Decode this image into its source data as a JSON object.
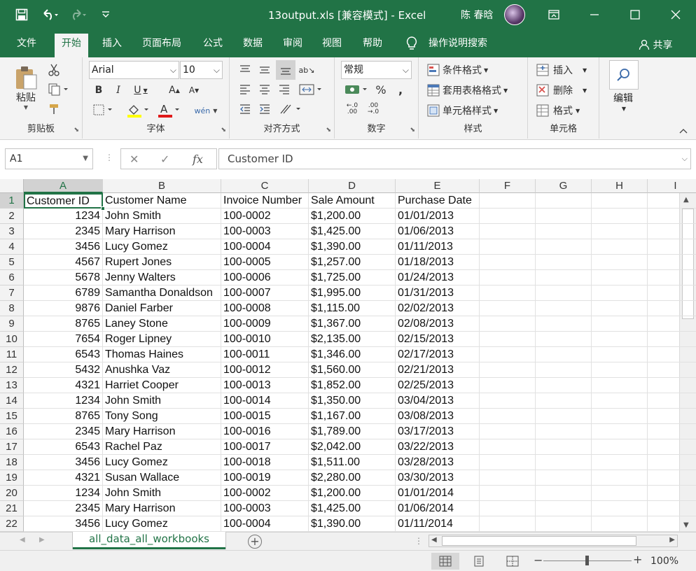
{
  "window": {
    "title": "13output.xls  [兼容模式]  -  Excel",
    "user": "陈 春晗"
  },
  "menu": {
    "tabs": [
      "文件",
      "开始",
      "插入",
      "页面布局",
      "公式",
      "数据",
      "审阅",
      "视图",
      "帮助"
    ],
    "active_tab": "开始",
    "tell_me": "操作说明搜索",
    "share": "共享"
  },
  "ribbon": {
    "clipboard": {
      "label": "剪贴板",
      "paste": "粘贴"
    },
    "font": {
      "label": "字体",
      "font_name": "Arial",
      "font_size": "10"
    },
    "alignment": {
      "label": "对齐方式"
    },
    "number": {
      "label": "数字",
      "format": "常规"
    },
    "styles": {
      "label": "样式",
      "conditional": "条件格式",
      "table": "套用表格格式",
      "cell_styles": "单元格样式"
    },
    "cells": {
      "label": "单元格",
      "insert": "插入",
      "delete": "删除",
      "format": "格式"
    },
    "editing": {
      "label": "编辑"
    }
  },
  "formula_bar": {
    "name_box": "A1",
    "content": "Customer ID"
  },
  "sheet": {
    "columns": [
      "A",
      "B",
      "C",
      "D",
      "E",
      "F",
      "G",
      "H",
      "I"
    ],
    "headers": [
      "Customer ID",
      "Customer Name",
      "Invoice Number",
      "Sale Amount",
      "Purchase Date"
    ],
    "rows": [
      [
        "1234",
        "John Smith",
        "100-0002",
        "$1,200.00",
        "01/01/2013"
      ],
      [
        "2345",
        "Mary Harrison",
        "100-0003",
        "$1,425.00",
        "01/06/2013"
      ],
      [
        "3456",
        "Lucy Gomez",
        "100-0004",
        "$1,390.00",
        "01/11/2013"
      ],
      [
        "4567",
        "Rupert Jones",
        "100-0005",
        "$1,257.00",
        "01/18/2013"
      ],
      [
        "5678",
        "Jenny Walters",
        "100-0006",
        "$1,725.00",
        "01/24/2013"
      ],
      [
        "6789",
        "Samantha Donaldson",
        "100-0007",
        "$1,995.00",
        "01/31/2013"
      ],
      [
        "9876",
        "Daniel Farber",
        "100-0008",
        "$1,115.00",
        "02/02/2013"
      ],
      [
        "8765",
        "Laney Stone",
        "100-0009",
        "$1,367.00",
        "02/08/2013"
      ],
      [
        "7654",
        "Roger Lipney",
        "100-0010",
        "$2,135.00",
        "02/15/2013"
      ],
      [
        "6543",
        "Thomas Haines",
        "100-0011",
        "$1,346.00",
        "02/17/2013"
      ],
      [
        "5432",
        "Anushka Vaz",
        "100-0012",
        "$1,560.00",
        "02/21/2013"
      ],
      [
        "4321",
        "Harriet Cooper",
        "100-0013",
        "$1,852.00",
        "02/25/2013"
      ],
      [
        "1234",
        "John Smith",
        "100-0014",
        "$1,350.00",
        "03/04/2013"
      ],
      [
        "8765",
        "Tony Song",
        "100-0015",
        "$1,167.00",
        "03/08/2013"
      ],
      [
        "2345",
        "Mary Harrison",
        "100-0016",
        "$1,789.00",
        "03/17/2013"
      ],
      [
        "6543",
        "Rachel Paz",
        "100-0017",
        "$2,042.00",
        "03/22/2013"
      ],
      [
        "3456",
        "Lucy Gomez",
        "100-0018",
        "$1,511.00",
        "03/28/2013"
      ],
      [
        "4321",
        "Susan Wallace",
        "100-0019",
        "$2,280.00",
        "03/30/2013"
      ],
      [
        "1234",
        "John Smith",
        "100-0002",
        "$1,200.00",
        "01/01/2014"
      ],
      [
        "2345",
        "Mary Harrison",
        "100-0003",
        "$1,425.00",
        "01/06/2014"
      ],
      [
        "3456",
        "Lucy Gomez",
        "100-0004",
        "$1,390.00",
        "01/11/2014"
      ]
    ]
  },
  "sheet_tabs": [
    "all_data_all_workbooks"
  ],
  "status": {
    "zoom": "100%"
  },
  "colors": {
    "accent": "#217346"
  }
}
